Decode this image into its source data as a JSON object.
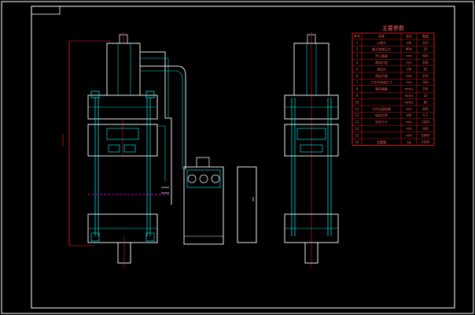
{
  "table": {
    "title": "主要参数",
    "headers": [
      "序号",
      "名称",
      "单位",
      "数值"
    ],
    "rows": [
      [
        "1",
        "公称力",
        "kN",
        "315"
      ],
      [
        "2",
        "最大液体压力",
        "MPa",
        "25"
      ],
      [
        "3",
        "开口高度",
        "mm",
        "600"
      ],
      [
        "4",
        "滑块行程",
        "mm",
        "400"
      ],
      [
        "5",
        "顶出力",
        "kN",
        "63"
      ],
      [
        "6",
        "顶出行程",
        "mm",
        "150"
      ],
      [
        "7",
        "工作台有效尺寸",
        "mm",
        "500"
      ],
      [
        "8",
        "滑块速度",
        "mm/s",
        "100"
      ],
      [
        "9",
        "",
        "mm/s",
        "10"
      ],
      [
        "10",
        "",
        "mm/s",
        "80"
      ],
      [
        "11",
        "工作台离地高",
        "mm",
        "800"
      ],
      [
        "12",
        "电机功率",
        "kW",
        "5.5"
      ],
      [
        "13",
        "外形尺寸",
        "mm",
        "1600"
      ],
      [
        "14",
        "",
        "mm",
        "900"
      ],
      [
        "15",
        "",
        "mm",
        "2600"
      ],
      [
        "16",
        "总重量",
        "kg",
        "2500"
      ]
    ]
  },
  "colors": {
    "background": "#000000",
    "frame": "#ffffff",
    "structure": "#00e0e0",
    "dimension": "#ff2020",
    "outline": "#e8e8e8",
    "accent": "#ff00ff"
  }
}
